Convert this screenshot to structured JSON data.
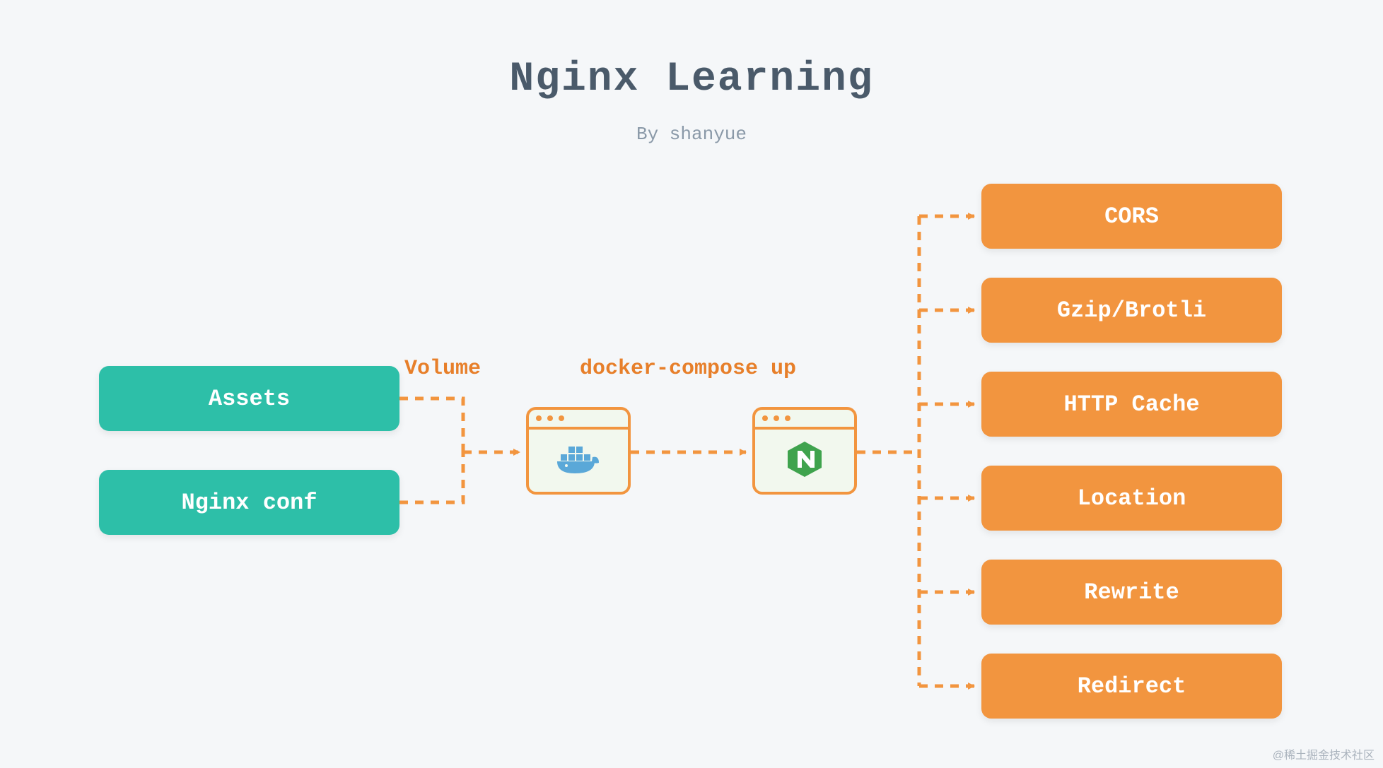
{
  "title": "Nginx Learning",
  "subtitle": "By shanyue",
  "labels": {
    "volume": "Volume",
    "compose": "docker-compose up"
  },
  "inputs": {
    "assets": "Assets",
    "nginx_conf": "Nginx conf"
  },
  "mid": {
    "docker": "docker",
    "nginx": "nginx"
  },
  "features": [
    "CORS",
    "Gzip/Brotli",
    "HTTP Cache",
    "Location",
    "Rewrite",
    "Redirect"
  ],
  "watermark": "@稀土掘金技术社区",
  "colors": {
    "teal": "#2dbfa8",
    "orange": "#f2953f",
    "bg": "#f5f7f9",
    "title": "#4a5a6a"
  }
}
